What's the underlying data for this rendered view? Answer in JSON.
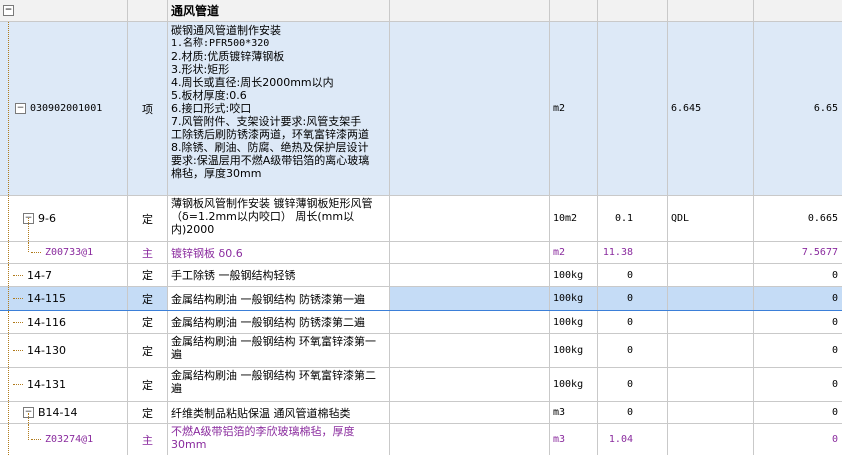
{
  "header": {
    "toggle": "−",
    "title": "通风管道"
  },
  "main_item": {
    "code": "030902001001",
    "type": "项",
    "name_lines": [
      "碳钢通风管道制作安装",
      "1.名称:PFR500*320",
      "2.材质:优质镀锌薄钢板",
      "3.形状:矩形",
      "4.周长或直径:周长2000mm以内",
      "5.板材厚度:0.6",
      "6.接口形式:咬口",
      "7.风管附件、支架设计要求:风管支架手",
      "工除锈后刷防锈漆两道，环氧富锌漆两道",
      "8.除锈、刷油、防腐、绝热及保护层设计",
      "要求:保温层用不燃A级带铝箔的离心玻璃",
      "棉毡，厚度30mm"
    ],
    "unit": "m2",
    "expr": "6.645",
    "total": "6.65"
  },
  "rows": [
    {
      "code": "9-6",
      "type": "定",
      "name": "薄钢板风管制作安装 镀锌薄钢板矩形风管（δ=1.2mm以内咬口） 周长(mm以内)2000",
      "unit": "10m2",
      "qty": "0.1",
      "expr": "QDL",
      "total": "0.665"
    },
    {
      "code": "Z00733@1",
      "type": "主",
      "name": "镀锌钢板 δ0.6",
      "unit": "m2",
      "qty": "11.38",
      "expr": "",
      "total": "7.5677"
    },
    {
      "code": "14-7",
      "type": "定",
      "name": "手工除锈 一般钢结构轻锈",
      "unit": "100kg",
      "qty": "0",
      "expr": "",
      "total": "0"
    },
    {
      "code": "14-115",
      "type": "定",
      "name": "金属结构刷油 一般钢结构 防锈漆第一遍",
      "unit": "100kg",
      "qty": "0",
      "expr": "",
      "total": "0"
    },
    {
      "code": "14-116",
      "type": "定",
      "name": "金属结构刷油 一般钢结构 防锈漆第二遍",
      "unit": "100kg",
      "qty": "0",
      "expr": "",
      "total": "0"
    },
    {
      "code": "14-130",
      "type": "定",
      "name": "金属结构刷油 一般钢结构 环氧富锌漆第一遍",
      "unit": "100kg",
      "qty": "0",
      "expr": "",
      "total": "0"
    },
    {
      "code": "14-131",
      "type": "定",
      "name": "金属结构刷油 一般钢结构 环氧富锌漆第二遍",
      "unit": "100kg",
      "qty": "0",
      "expr": "",
      "total": "0"
    },
    {
      "code": "B14-14",
      "type": "定",
      "name": "纤维类制品粘贴保温 通风管道棉毡类",
      "unit": "m3",
      "qty": "0",
      "expr": "",
      "total": "0"
    },
    {
      "code": "Z03274@1",
      "type": "主",
      "name": "不燃A级带铝箔的李欣玻璃棉毡，厚度30mm",
      "unit": "m3",
      "qty": "1.04",
      "expr": "",
      "total": "0"
    }
  ],
  "toggle_symbol": "−",
  "colors": {
    "selection": "#c5dcf6",
    "selection_border": "#3b7fd8",
    "item_bg": "#dde9f7",
    "material_text": "#8a2b9e"
  }
}
